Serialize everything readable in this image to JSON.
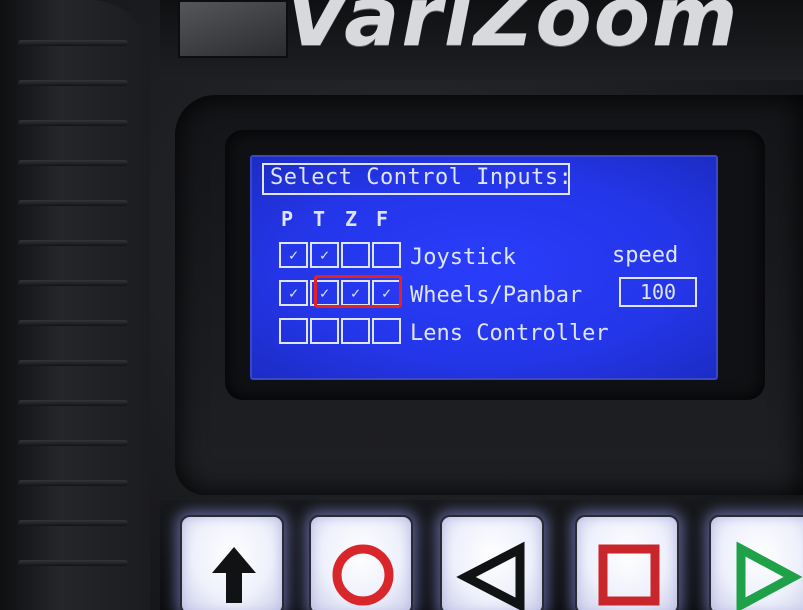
{
  "brand": {
    "text": "VariZoom"
  },
  "lcd": {
    "title": "Select Control Inputs:",
    "columns": [
      "P",
      "T",
      "Z",
      "F"
    ],
    "check_glyph": "✓",
    "rows": [
      {
        "label": "Joystick",
        "checks": [
          true,
          true,
          false,
          false
        ]
      },
      {
        "label": "Wheels/Panbar",
        "checks": [
          true,
          true,
          true,
          true
        ]
      },
      {
        "label": "Lens Controller",
        "checks": [
          false,
          false,
          false,
          false
        ]
      }
    ],
    "speed_label": "speed",
    "speed_value": "100"
  },
  "keys": [
    {
      "icon": "up-arrow-icon"
    },
    {
      "icon": "circle-icon"
    },
    {
      "icon": "left-triangle-icon"
    },
    {
      "icon": "square-icon"
    },
    {
      "icon": "play-icon"
    }
  ],
  "colors": {
    "lcd_background": "#2436e8",
    "lcd_text": "#dfe5ff",
    "highlight": "#e8211f",
    "circle": "#d8262b",
    "square": "#c8262b",
    "play": "#1fa14a"
  }
}
